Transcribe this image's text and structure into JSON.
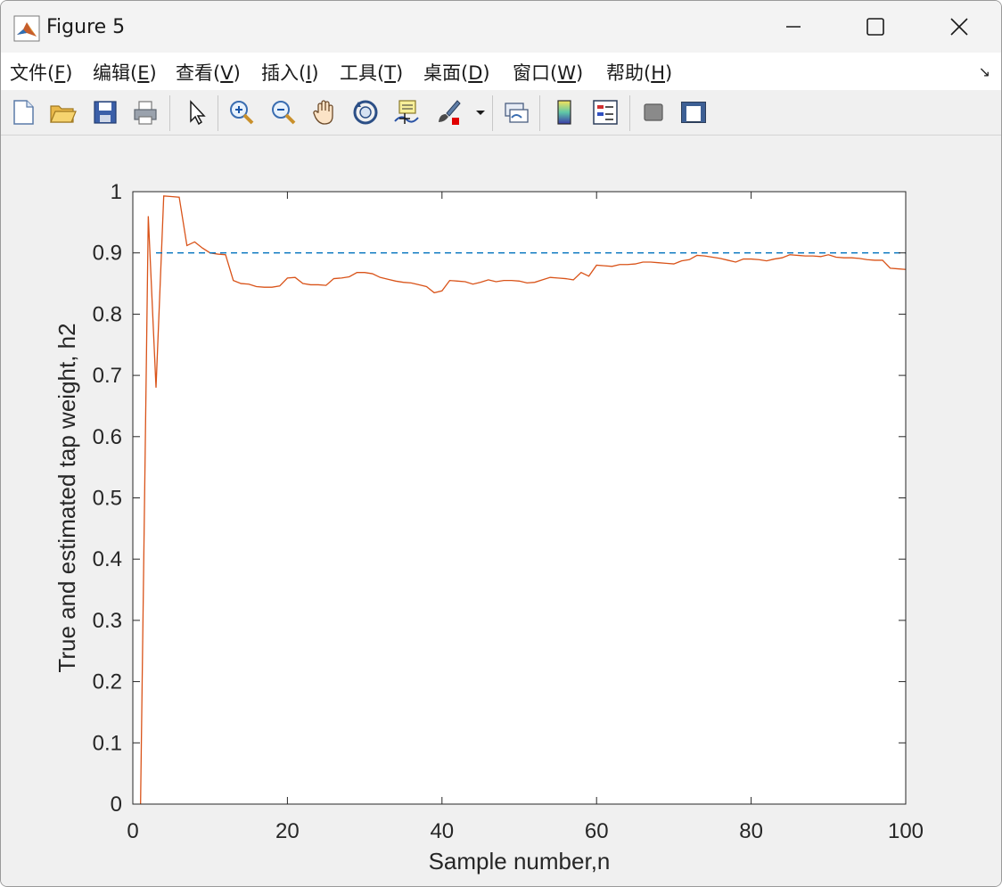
{
  "window": {
    "title": "Figure 5"
  },
  "menu": [
    {
      "label": "文件(",
      "key": "F",
      "end": ")"
    },
    {
      "label": "编辑(",
      "key": "E",
      "end": ")"
    },
    {
      "label": "查看(",
      "key": "V",
      "end": ")"
    },
    {
      "label": "插入(",
      "key": "I",
      "end": ")"
    },
    {
      "label": "工具(",
      "key": "T",
      "end": ")"
    },
    {
      "label": "桌面(",
      "key": "D",
      "end": ")"
    },
    {
      "label": "窗口(",
      "key": "W",
      "end": ")"
    },
    {
      "label": "帮助(",
      "key": "H",
      "end": ")"
    }
  ],
  "toolbar": {
    "icons": [
      "new-file-icon",
      "open-folder-icon",
      "save-icon",
      "print-icon",
      "select-pointer-icon",
      "zoom-in-icon",
      "zoom-out-icon",
      "pan-hand-icon",
      "rotate-3d-icon",
      "data-cursor-icon",
      "brush-icon",
      "link-plot-icon",
      "colorbar-icon",
      "legend-icon",
      "hide-plot-tools-icon",
      "show-plot-tools-icon"
    ]
  },
  "colors": {
    "estimate": "#d95319",
    "true_value": "#0072bd"
  },
  "chart_data": {
    "type": "line",
    "xlabel": "Sample number,n",
    "ylabel": "True and estimated tap weight, h2",
    "xlim": [
      0,
      100
    ],
    "ylim": [
      0,
      1
    ],
    "xticks": [
      0,
      20,
      40,
      60,
      80,
      100
    ],
    "yticks": [
      0,
      0.1,
      0.2,
      0.3,
      0.4,
      0.5,
      0.6,
      0.7,
      0.8,
      0.9,
      1
    ],
    "ytick_labels": [
      "0",
      "0.1",
      "0.2",
      "0.3",
      "0.4",
      "0.5",
      "0.6",
      "0.7",
      "0.8",
      "0.9",
      "1"
    ],
    "grid": false,
    "series": [
      {
        "style": "solid",
        "color": "#d95319",
        "x": [
          1,
          2,
          3,
          4,
          5,
          6,
          7,
          8,
          9,
          10,
          11,
          12,
          13,
          14,
          15,
          16,
          17,
          18,
          19,
          20,
          21,
          22,
          23,
          24,
          25,
          26,
          27,
          28,
          29,
          30,
          31,
          32,
          33,
          34,
          35,
          36,
          37,
          38,
          39,
          40,
          41,
          42,
          43,
          44,
          45,
          46,
          47,
          48,
          49,
          50,
          51,
          52,
          53,
          54,
          55,
          56,
          57,
          58,
          59,
          60,
          61,
          62,
          63,
          64,
          65,
          66,
          67,
          68,
          69,
          70,
          71,
          72,
          73,
          74,
          75,
          76,
          77,
          78,
          79,
          80,
          81,
          82,
          83,
          84,
          85,
          86,
          87,
          88,
          89,
          90,
          91,
          92,
          93,
          94,
          95,
          96,
          97,
          98,
          99,
          100
        ],
        "y": [
          0,
          0.96,
          0.68,
          0.993,
          0.992,
          0.991,
          0.912,
          0.918,
          0.908,
          0.9,
          0.898,
          0.897,
          0.855,
          0.85,
          0.849,
          0.845,
          0.844,
          0.844,
          0.846,
          0.859,
          0.86,
          0.85,
          0.848,
          0.848,
          0.847,
          0.858,
          0.859,
          0.861,
          0.868,
          0.868,
          0.866,
          0.86,
          0.857,
          0.854,
          0.852,
          0.851,
          0.848,
          0.845,
          0.835,
          0.838,
          0.855,
          0.854,
          0.853,
          0.849,
          0.852,
          0.856,
          0.853,
          0.855,
          0.855,
          0.854,
          0.851,
          0.852,
          0.856,
          0.86,
          0.859,
          0.858,
          0.856,
          0.868,
          0.862,
          0.88,
          0.879,
          0.878,
          0.881,
          0.881,
          0.882,
          0.885,
          0.885,
          0.884,
          0.883,
          0.882,
          0.887,
          0.889,
          0.896,
          0.895,
          0.893,
          0.891,
          0.888,
          0.885,
          0.89,
          0.89,
          0.889,
          0.887,
          0.89,
          0.892,
          0.897,
          0.896,
          0.895,
          0.895,
          0.894,
          0.897,
          0.893,
          0.892,
          0.892,
          0.891,
          0.889,
          0.888,
          0.888,
          0.875,
          0.874,
          0.873
        ]
      },
      {
        "style": "dashed",
        "color": "#0072bd",
        "x": [
          3,
          100
        ],
        "y": [
          0.9,
          0.9
        ]
      }
    ]
  }
}
